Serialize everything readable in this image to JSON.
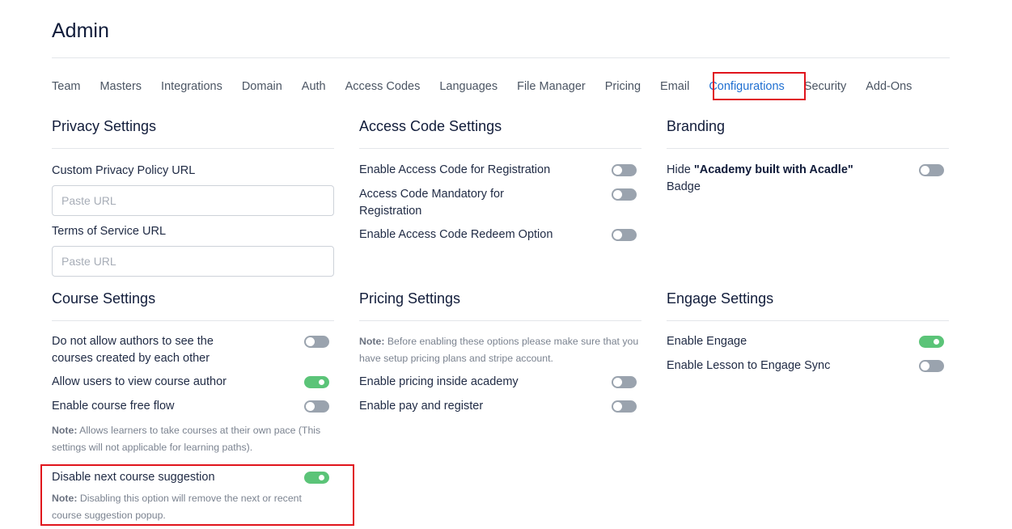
{
  "page": {
    "title": "Admin"
  },
  "tabs": [
    {
      "label": "Team"
    },
    {
      "label": "Masters"
    },
    {
      "label": "Integrations"
    },
    {
      "label": "Domain"
    },
    {
      "label": "Auth"
    },
    {
      "label": "Access Codes"
    },
    {
      "label": "Languages"
    },
    {
      "label": "File Manager"
    },
    {
      "label": "Pricing"
    },
    {
      "label": "Email"
    },
    {
      "label": "Configurations",
      "active": true
    },
    {
      "label": "Security"
    },
    {
      "label": "Add-Ons"
    }
  ],
  "privacy": {
    "title": "Privacy Settings",
    "privacy_label": "Custom Privacy Policy URL",
    "privacy_placeholder": "Paste URL",
    "privacy_value": "",
    "terms_label": "Terms of Service URL",
    "terms_placeholder": "Paste URL",
    "terms_value": ""
  },
  "access_code": {
    "title": "Access Code Settings",
    "items": [
      {
        "label": "Enable Access Code for Registration",
        "on": false
      },
      {
        "label": "Access Code Mandatory for Registration",
        "on": false
      },
      {
        "label": "Enable Access Code Redeem Option",
        "on": false
      }
    ]
  },
  "branding": {
    "title": "Branding",
    "label_prefix": "Hide",
    "label_bold": "\"Academy built with Acadle\"",
    "label_suffix": "Badge",
    "on": false
  },
  "course": {
    "title": "Course Settings",
    "items": [
      {
        "label": "Do not allow authors to see the courses created by each other",
        "on": false
      },
      {
        "label": "Allow users to view course author",
        "on": true
      },
      {
        "label": "Enable course free flow",
        "on": false
      },
      {
        "label": "Disable next course suggestion",
        "on": true
      }
    ],
    "free_flow_note_label": "Note:",
    "free_flow_note": "Allows learners to take courses at their own pace (This settings will not applicable for learning paths).",
    "suggestion_note_label": "Note:",
    "suggestion_note": "Disabling this option will remove the next or recent course suggestion popup."
  },
  "pricing": {
    "title": "Pricing Settings",
    "note_label": "Note:",
    "note": "Before enabling these options please make sure that you have setup pricing plans and stripe account.",
    "items": [
      {
        "label": "Enable pricing inside academy",
        "on": false
      },
      {
        "label": "Enable pay and register",
        "on": false
      }
    ]
  },
  "engage": {
    "title": "Engage Settings",
    "items": [
      {
        "label": "Enable Engage",
        "on": true
      },
      {
        "label": "Enable Lesson to Engage Sync",
        "on": false
      }
    ]
  },
  "colors": {
    "accent": "#1f6fd1",
    "toggle_on": "#5bc478",
    "toggle_off": "#9aa3ae",
    "highlight": "#e0141c"
  }
}
